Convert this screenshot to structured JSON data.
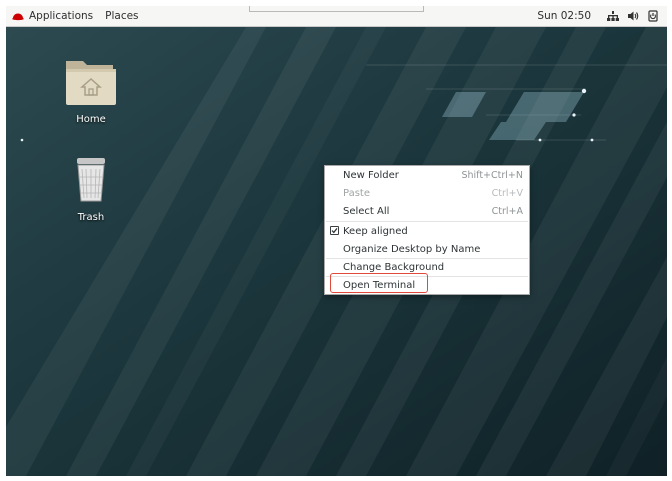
{
  "topbar": {
    "applications_label": "Applications",
    "places_label": "Places",
    "clock": "Sun 02:50",
    "icons": [
      "redhat-icon",
      "network-icon",
      "volume-icon",
      "power-icon"
    ]
  },
  "desktop": {
    "icons": [
      {
        "label": "Home",
        "icon": "folder-home-icon"
      },
      {
        "label": "Trash",
        "icon": "trash-icon"
      }
    ]
  },
  "context_menu": {
    "items": [
      {
        "label": "New Folder",
        "shortcut": "Shift+Ctrl+N",
        "enabled": true
      },
      {
        "label": "Paste",
        "shortcut": "Ctrl+V",
        "enabled": false
      },
      {
        "label": "Select All",
        "shortcut": "Ctrl+A",
        "enabled": true
      },
      {
        "label": "Keep aligned",
        "checked": true,
        "enabled": true
      },
      {
        "label": "Organize Desktop by Name",
        "enabled": true
      },
      {
        "label": "Change Background",
        "enabled": true
      },
      {
        "label": "Open Terminal",
        "enabled": true,
        "highlighted": true
      }
    ]
  },
  "colors": {
    "highlight_border": "#e04a3a",
    "desktop_bg": "#183036",
    "brand_red": "#cc0000"
  }
}
